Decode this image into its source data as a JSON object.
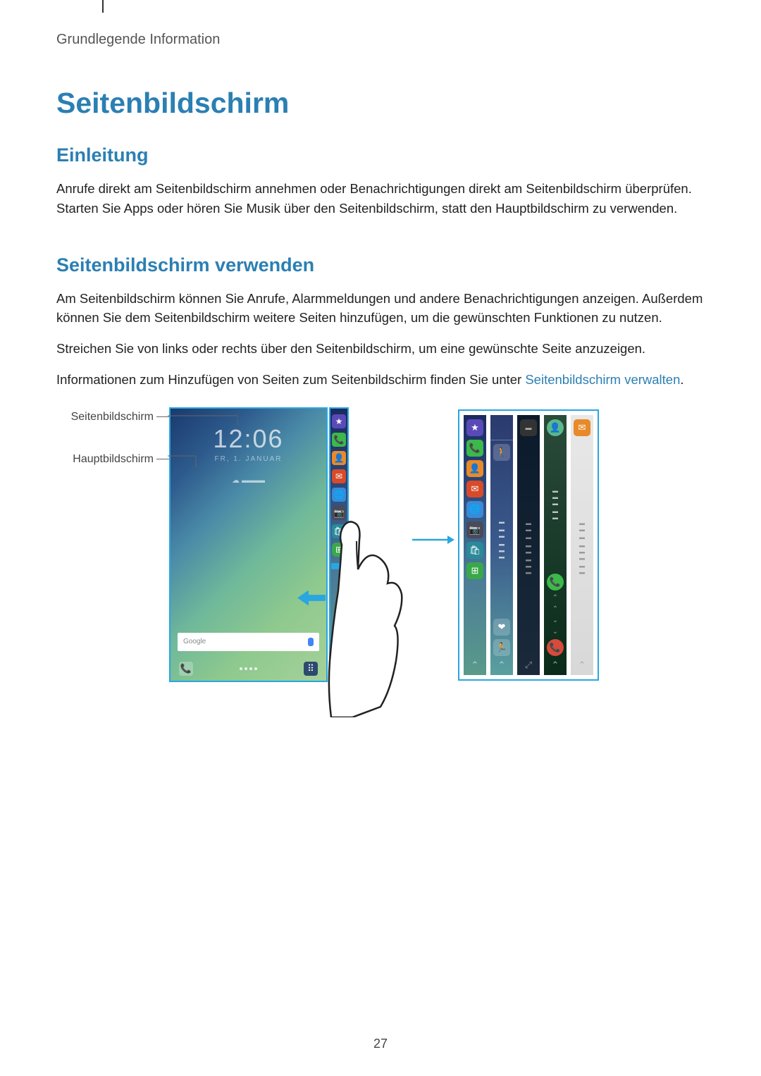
{
  "header": "Grundlegende Information",
  "title": "Seitenbildschirm",
  "section1": {
    "heading": "Einleitung",
    "body": "Anrufe direkt am Seitenbildschirm annehmen oder Benachrichtigungen direkt am Seitenbildschirm überprüfen. Starten Sie Apps oder hören Sie Musik über den Seitenbildschirm, statt den Hauptbildschirm zu verwenden."
  },
  "section2": {
    "heading": "Seitenbildschirm verwenden",
    "body1": "Am Seitenbildschirm können Sie Anrufe, Alarmmeldungen und andere Benachrichtigungen anzeigen. Außerdem können Sie dem Seitenbildschirm weitere Seiten hinzufügen, um die gewünschten Funktionen zu nutzen.",
    "body2": "Streichen Sie von links oder rechts über den Seitenbildschirm, um eine gewünschte Seite anzuzeigen.",
    "body3_pre": "Informationen zum Hinzufügen von Seiten zum Seitenbildschirm finden Sie unter ",
    "body3_link": "Seitenbildschirm verwalten",
    "body3_post": "."
  },
  "labels": {
    "edge": "Seitenbildschirm",
    "main": "Hauptbildschirm"
  },
  "phone": {
    "time": "12:06",
    "date": "FR, 1. JANUAR",
    "search_placeholder": "Google"
  },
  "page_number": "27"
}
